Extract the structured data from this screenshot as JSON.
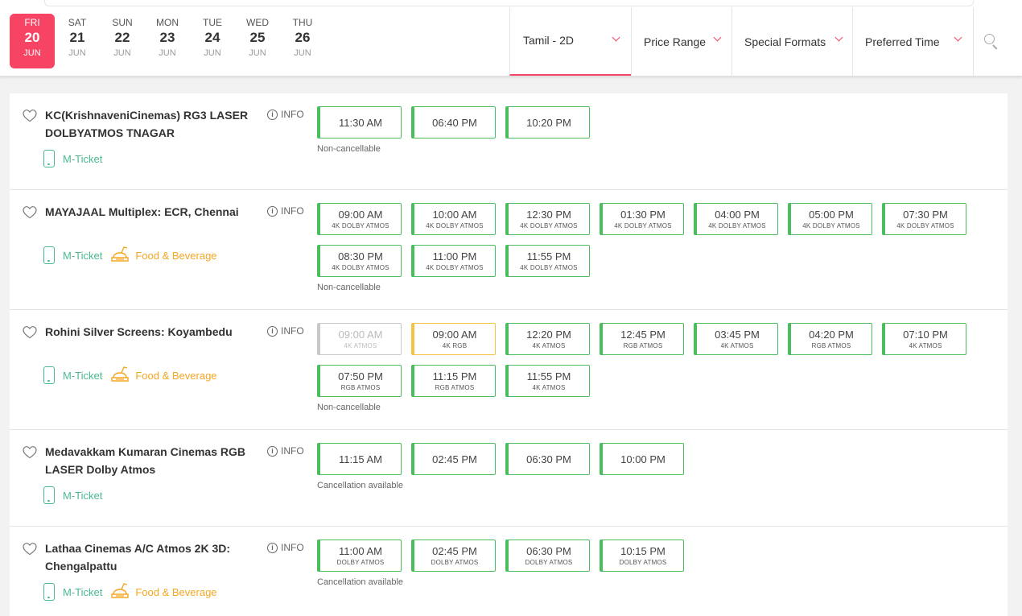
{
  "dates": [
    {
      "dow": "FRI",
      "day": "20",
      "mon": "JUN",
      "active": true
    },
    {
      "dow": "SAT",
      "day": "21",
      "mon": "JUN"
    },
    {
      "dow": "SUN",
      "day": "22",
      "mon": "JUN"
    },
    {
      "dow": "MON",
      "day": "23",
      "mon": "JUN"
    },
    {
      "dow": "TUE",
      "day": "24",
      "mon": "JUN"
    },
    {
      "dow": "WED",
      "day": "25",
      "mon": "JUN"
    },
    {
      "dow": "THU",
      "day": "26",
      "mon": "JUN"
    }
  ],
  "filters": {
    "language": "Tamil - 2D",
    "price": "Price Range",
    "formats": "Special Formats",
    "time": "Preferred Time"
  },
  "colors": {
    "accent": "#f84464",
    "available": "#4abd5d",
    "fast": "#f5c243",
    "mticket": "#49ba8e",
    "food": "#f5a623"
  },
  "labels": {
    "info": "INFO",
    "mticket": "M-Ticket",
    "food": "Food & Beverage"
  },
  "venues": [
    {
      "name": "KC(KrishnaveniCinemas) RG3 LASER DOLBYATMOS TNAGAR",
      "food": false,
      "note": "Non-cancellable",
      "rows": [
        [
          {
            "t": "11:30 AM",
            "f": ""
          },
          {
            "t": "06:40 PM",
            "f": ""
          },
          {
            "t": "10:20 PM",
            "f": ""
          }
        ]
      ]
    },
    {
      "name": "MAYAJAAL Multiplex: ECR, Chennai",
      "food": true,
      "note": "Non-cancellable",
      "rows": [
        [
          {
            "t": "09:00 AM",
            "f": "4K DOLBY ATMOS"
          },
          {
            "t": "10:00 AM",
            "f": "4K DOLBY ATMOS"
          },
          {
            "t": "12:30 PM",
            "f": "4K DOLBY ATMOS"
          },
          {
            "t": "01:30 PM",
            "f": "4K DOLBY ATMOS"
          },
          {
            "t": "04:00 PM",
            "f": "4K DOLBY ATMOS"
          },
          {
            "t": "05:00 PM",
            "f": "4K DOLBY ATMOS"
          },
          {
            "t": "07:30 PM",
            "f": "4K DOLBY ATMOS"
          }
        ],
        [
          {
            "t": "08:30 PM",
            "f": "4K DOLBY ATMOS"
          },
          {
            "t": "11:00 PM",
            "f": "4K DOLBY ATMOS"
          },
          {
            "t": "11:55 PM",
            "f": "4K DOLBY ATMOS"
          }
        ]
      ]
    },
    {
      "name": "Rohini Silver Screens: Koyambedu",
      "food": true,
      "note": "Non-cancellable",
      "rows": [
        [
          {
            "t": "09:00 AM",
            "f": "4K ATMOS",
            "state": "disabled"
          },
          {
            "t": "09:00 AM",
            "f": "4K RGB",
            "state": "fast"
          },
          {
            "t": "12:20 PM",
            "f": "4K ATMOS"
          },
          {
            "t": "12:45 PM",
            "f": "RGB ATMOS"
          },
          {
            "t": "03:45 PM",
            "f": "4K ATMOS"
          },
          {
            "t": "04:20 PM",
            "f": "RGB ATMOS"
          },
          {
            "t": "07:10 PM",
            "f": "4K ATMOS"
          }
        ],
        [
          {
            "t": "07:50 PM",
            "f": "RGB ATMOS"
          },
          {
            "t": "11:15 PM",
            "f": "RGB ATMOS"
          },
          {
            "t": "11:55 PM",
            "f": "4K ATMOS"
          }
        ]
      ]
    },
    {
      "name": "Medavakkam Kumaran Cinemas RGB LASER Dolby Atmos",
      "food": false,
      "note": "Cancellation available",
      "rows": [
        [
          {
            "t": "11:15 AM",
            "f": ""
          },
          {
            "t": "02:45 PM",
            "f": ""
          },
          {
            "t": "06:30 PM",
            "f": ""
          },
          {
            "t": "10:00 PM",
            "f": ""
          }
        ]
      ]
    },
    {
      "name": "Lathaa Cinemas A/C Atmos 2K 3D: Chengalpattu",
      "food": true,
      "note": "Cancellation available",
      "rows": [
        [
          {
            "t": "11:00 AM",
            "f": "DOLBY ATMOS"
          },
          {
            "t": "02:45 PM",
            "f": "DOLBY ATMOS"
          },
          {
            "t": "06:30 PM",
            "f": "DOLBY ATMOS"
          },
          {
            "t": "10:15 PM",
            "f": "DOLBY ATMOS"
          }
        ]
      ]
    }
  ]
}
